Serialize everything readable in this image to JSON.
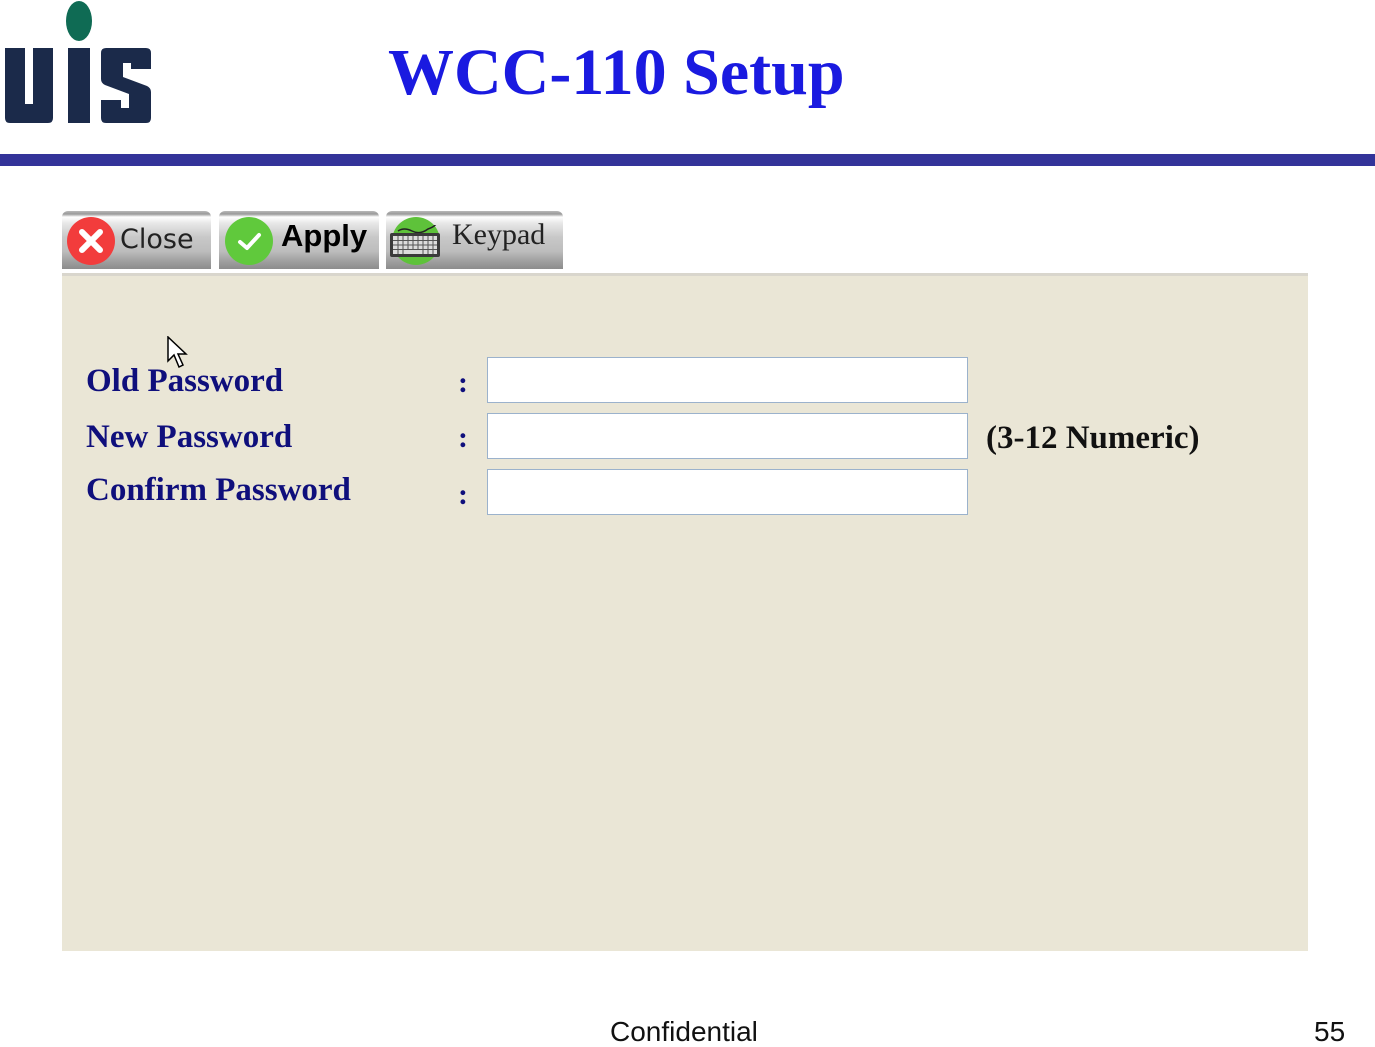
{
  "slide": {
    "title": "WCC-110 Setup",
    "logo_text": "UIS",
    "footer_label": "Confidential",
    "page_number": "55",
    "colors": {
      "title": "#1a1ae0",
      "rule": "#333399",
      "logo_letters": "#1b2a4a",
      "logo_dot": "#0f6b54"
    }
  },
  "toolbar": {
    "buttons": [
      {
        "label": "Close",
        "icon": "close-x-icon",
        "color": "#f23c3c"
      },
      {
        "label": "Apply",
        "icon": "check-icon",
        "color": "#60c93c"
      },
      {
        "label": "Keypad",
        "icon": "keyboard-icon",
        "color": "#5ec23a"
      }
    ]
  },
  "form": {
    "separator": ":",
    "fields": [
      {
        "label": "Old Password",
        "value": "",
        "placeholder": ""
      },
      {
        "label": "New Password",
        "value": "",
        "placeholder": ""
      },
      {
        "label": "Confirm Password",
        "value": "",
        "placeholder": ""
      }
    ],
    "hint": "(3-12 Numeric)",
    "colors": {
      "label": "#0f0f7c",
      "panel_bg": "#eae6d6"
    }
  }
}
